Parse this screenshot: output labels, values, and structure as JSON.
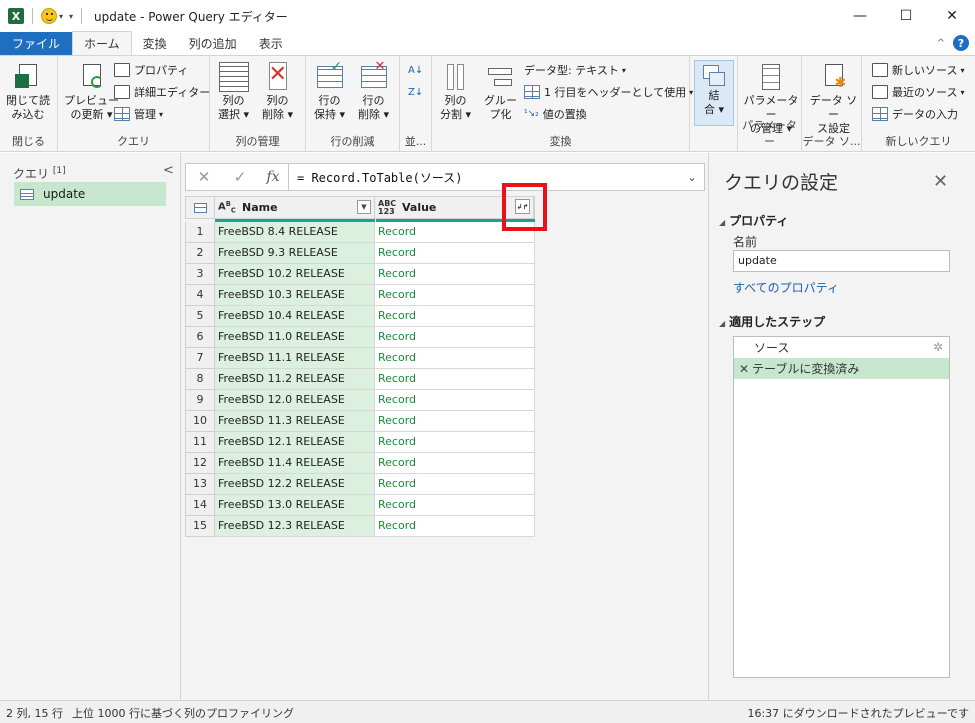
{
  "titlebar": {
    "logo": "X",
    "title": "update - Power Query エディター",
    "minimize": "—",
    "maximize": "☐",
    "close": "✕"
  },
  "tabs": {
    "file": "ファイル",
    "home": "ホーム",
    "transform": "変換",
    "add_column": "列の追加",
    "view": "表示",
    "help": "?",
    "collapse": "^"
  },
  "ribbon": {
    "close_load": "閉じて読み込む",
    "close_load_l1": "閉じて読",
    "close_load_l2": "み込む",
    "close_group": "閉じる",
    "preview_refresh_l1": "プレビュー",
    "preview_refresh_l2": "の更新",
    "properties": "プロパティ",
    "advanced_editor": "詳細エディター",
    "manage": "管理",
    "query_group": "クエリ",
    "choose_columns_l1": "列の",
    "choose_columns_l2": "選択",
    "remove_columns_l1": "列の",
    "remove_columns_l2": "削除",
    "manage_columns_group": "列の管理",
    "keep_rows_l1": "行の",
    "keep_rows_l2": "保持",
    "remove_rows_l1": "行の",
    "remove_rows_l2": "削除",
    "reduce_rows_group": "行の削減",
    "sort_group": "並...",
    "split_column_l1": "列の",
    "split_column_l2": "分割",
    "group_by_l1": "グルー",
    "group_by_l2": "プ化",
    "data_type": "データ型: テキスト",
    "use_first_row": "1 行目をヘッダーとして使用",
    "replace_values": "値の置換",
    "transform_group": "変換",
    "combine_l1": "結",
    "combine_l2": "合",
    "manage_params_l1": "パラメーター",
    "manage_params_l2": "の管理",
    "params_group": "パラメーター",
    "data_source_l1": "データ ソー",
    "data_source_l2": "ス設定",
    "data_source_group": "データ ソ...",
    "new_source": "新しいソース",
    "recent_sources": "最近のソース",
    "enter_data": "データの入力",
    "new_query_group": "新しいクエリ"
  },
  "left_pane": {
    "header": "クエリ",
    "count": "[1]",
    "collapse": "<",
    "query_name": "update"
  },
  "formula_bar": {
    "cancel": "✕",
    "commit": "✓",
    "fx": "fx",
    "formula": "= Record.ToTable(ソース)",
    "expand": "⌄"
  },
  "grid": {
    "col1_type_top": "A",
    "col1_type_sub": "B",
    "col1_type_c": "C",
    "col1_header": "Name",
    "col2_type_top": "ABC",
    "col2_type_bottom": "123",
    "col2_header": "Value",
    "rows": [
      {
        "n": "1",
        "name": "FreeBSD  8.4 RELEASE",
        "value": "Record"
      },
      {
        "n": "2",
        "name": "FreeBSD  9.3 RELEASE",
        "value": "Record"
      },
      {
        "n": "3",
        "name": "FreeBSD 10.2 RELEASE",
        "value": "Record"
      },
      {
        "n": "4",
        "name": "FreeBSD 10.3 RELEASE",
        "value": "Record"
      },
      {
        "n": "5",
        "name": "FreeBSD 10.4 RELEASE",
        "value": "Record"
      },
      {
        "n": "6",
        "name": "FreeBSD 11.0 RELEASE",
        "value": "Record"
      },
      {
        "n": "7",
        "name": "FreeBSD 11.1 RELEASE",
        "value": "Record"
      },
      {
        "n": "8",
        "name": "FreeBSD 11.2 RELEASE",
        "value": "Record"
      },
      {
        "n": "9",
        "name": "FreeBSD 12.0 RELEASE",
        "value": "Record"
      },
      {
        "n": "10",
        "name": "FreeBSD 11.3 RELEASE",
        "value": "Record"
      },
      {
        "n": "11",
        "name": "FreeBSD 12.1 RELEASE",
        "value": "Record"
      },
      {
        "n": "12",
        "name": "FreeBSD 11.4 RELEASE",
        "value": "Record"
      },
      {
        "n": "13",
        "name": "FreeBSD 12.2 RELEASE",
        "value": "Record"
      },
      {
        "n": "14",
        "name": "FreeBSD 13.0 RELEASE",
        "value": "Record"
      },
      {
        "n": "15",
        "name": "FreeBSD 12.3 RELEASE",
        "value": "Record"
      }
    ]
  },
  "right_pane": {
    "title": "クエリの設定",
    "close": "✕",
    "properties_section": "プロパティ",
    "name_label": "名前",
    "name_value": "update",
    "all_properties": "すべてのプロパティ",
    "applied_steps_section": "適用したステップ",
    "steps": [
      {
        "label": "ソース"
      },
      {
        "label": "テーブルに変換済み"
      }
    ]
  },
  "status_bar": {
    "left": "2 列, 15 行",
    "middle": "上位 1000 行に基づく列のプロファイリング",
    "right": "16:37 にダウンロードされたプレビューです"
  },
  "colors": {
    "accent_blue": "#1e6fbf",
    "selected_green": "#c6e6cd",
    "quality_bar": "#1aa58b",
    "highlight_red": "#e8121c",
    "record_green": "#1a8a3a"
  }
}
